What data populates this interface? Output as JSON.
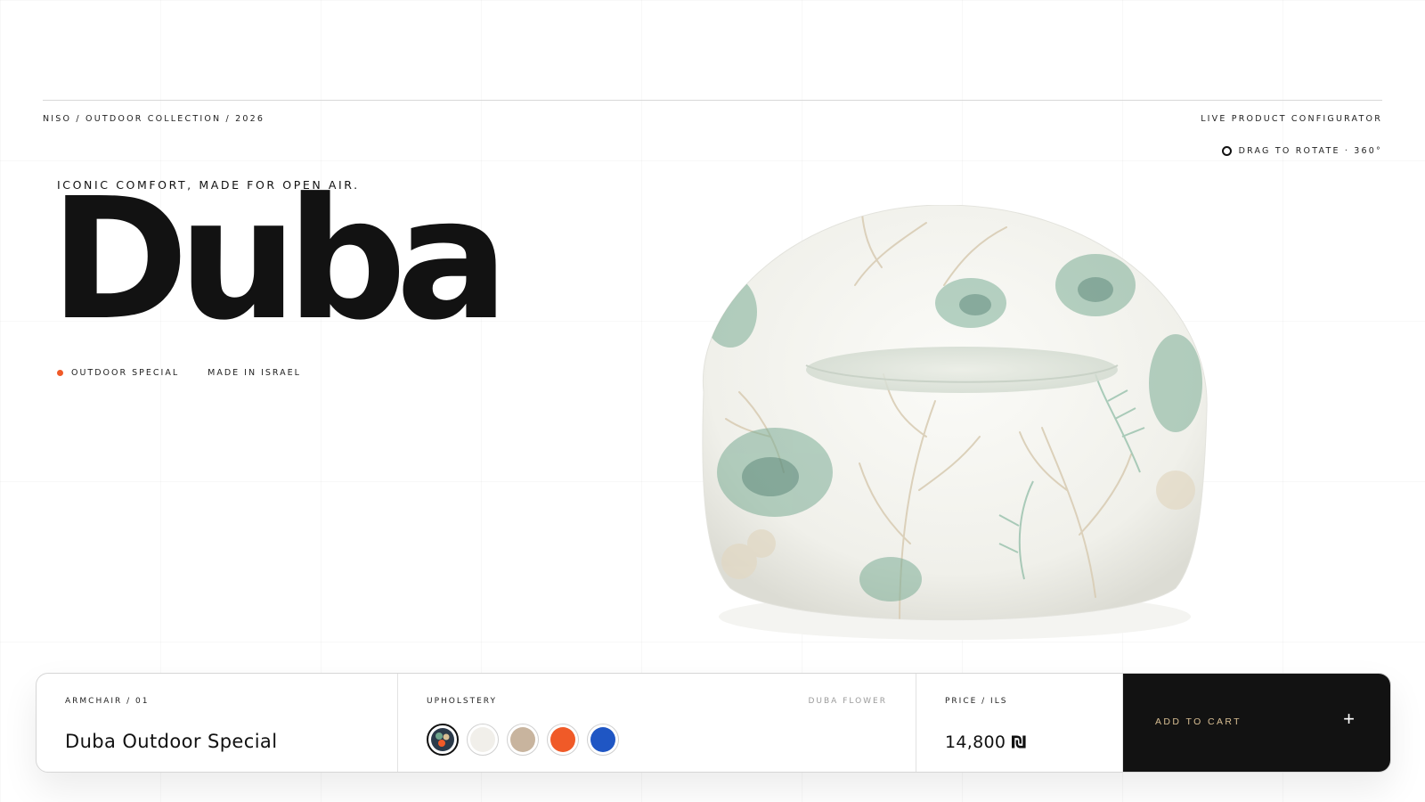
{
  "header": {
    "breadcrumb": "NISO / OUTDOOR COLLECTION / 2026",
    "configurator_label": "LIVE PRODUCT CONFIGURATOR",
    "rotate_hint": "DRAG TO ROTATE · 360°"
  },
  "hero": {
    "tagline": "ICONIC COMFORT, MADE FOR OPEN AIR.",
    "title": "Duba",
    "badges": [
      "OUTDOOR SPECIAL",
      "MADE IN ISRAEL"
    ]
  },
  "colors": {
    "accent": "#f05a28",
    "cart_bg": "#121212",
    "cart_text": "#d9bf94",
    "fabric_green": "#6fa58c",
    "fabric_coral": "#d9cdb5"
  },
  "bar": {
    "product_label": "ARMCHAIR / 01",
    "product_name": "Duba Outdoor Special",
    "upholstery_label": "UPHOLSTERY",
    "finish_name": "DUBA FLOWER",
    "swatches": [
      {
        "name": "duba-flower",
        "selected": true
      },
      {
        "name": "white",
        "color": "#f1efea"
      },
      {
        "name": "sand",
        "color": "#c8b49e"
      },
      {
        "name": "orange",
        "color": "#f05a28"
      },
      {
        "name": "blue",
        "color": "#1f56c4"
      }
    ],
    "price_label": "PRICE / ILS",
    "price_value": "14,800",
    "currency_symbol": "₪",
    "cart_label": "ADD TO CART",
    "cart_icon": "+"
  }
}
